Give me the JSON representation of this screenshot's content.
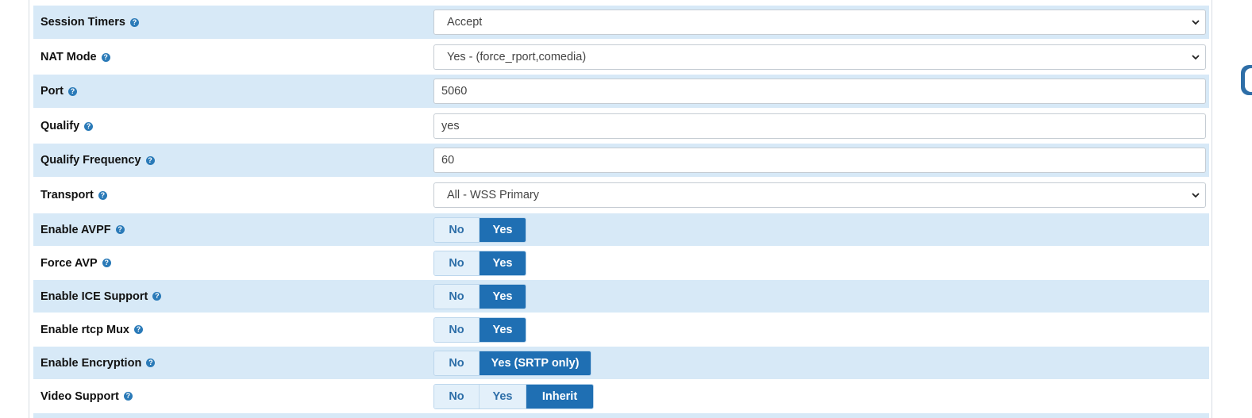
{
  "rows": [
    {
      "label": "Session Timers",
      "kind": "select",
      "value": "Accept"
    },
    {
      "label": "NAT Mode",
      "kind": "select",
      "value": "Yes - (force_rport,comedia)"
    },
    {
      "label": "Port",
      "kind": "input",
      "value": "5060"
    },
    {
      "label": "Qualify",
      "kind": "input",
      "value": "yes"
    },
    {
      "label": "Qualify Frequency",
      "kind": "input",
      "value": "60"
    },
    {
      "label": "Transport",
      "kind": "select",
      "value": "All - WSS Primary"
    },
    {
      "label": "Enable AVPF",
      "kind": "toggle",
      "options": [
        "No",
        "Yes"
      ],
      "selected": "Yes"
    },
    {
      "label": "Force AVP",
      "kind": "toggle",
      "options": [
        "No",
        "Yes"
      ],
      "selected": "Yes"
    },
    {
      "label": "Enable ICE Support",
      "kind": "toggle",
      "options": [
        "No",
        "Yes"
      ],
      "selected": "Yes"
    },
    {
      "label": "Enable rtcp Mux",
      "kind": "toggle",
      "options": [
        "No",
        "Yes"
      ],
      "selected": "Yes"
    },
    {
      "label": "Enable Encryption",
      "kind": "toggle",
      "options": [
        "No",
        "Yes (SRTP only)"
      ],
      "selected": "Yes (SRTP only)"
    },
    {
      "label": "Video Support",
      "kind": "toggle",
      "options": [
        "No",
        "Yes",
        "Inherit"
      ],
      "selected": "Inherit"
    }
  ],
  "help_icon_glyph": "?",
  "colors": {
    "row_shade": "#d7e9f7",
    "toggle_active": "#1f6fb3",
    "toggle_inactive": "#e3f0fa",
    "help_icon": "#2a7ab8"
  }
}
